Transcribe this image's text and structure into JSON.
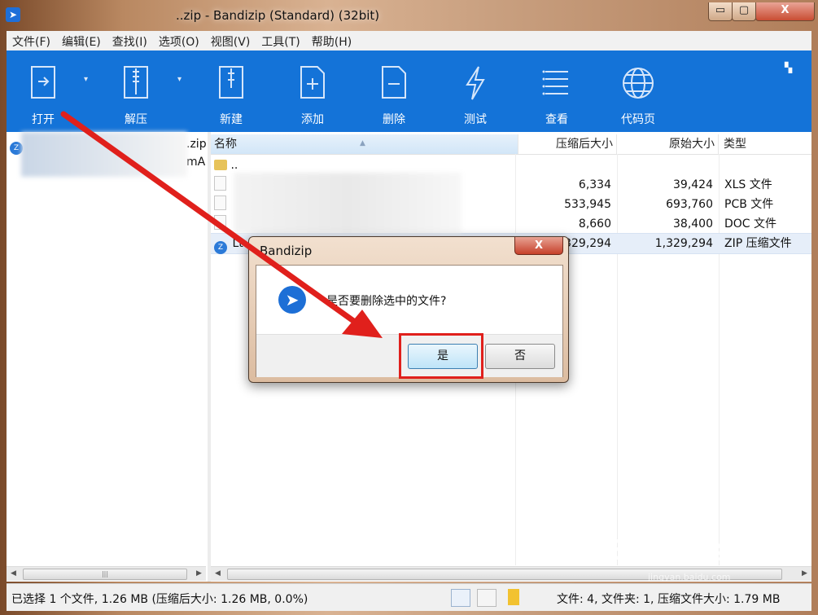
{
  "window": {
    "title": "..zip - Bandizip (Standard) (32bit)",
    "minimize": "▭",
    "maximize": "▢",
    "close": "X"
  },
  "menu": [
    "文件(F)",
    "编辑(E)",
    "查找(I)",
    "选项(O)",
    "视图(V)",
    "工具(T)",
    "帮助(H)"
  ],
  "toolbar": {
    "open": "打开",
    "extract": "解压",
    "new": "新建",
    "add": "添加",
    "delete": "删除",
    "test": "测试",
    "view": "查看",
    "codepage": "代码页"
  },
  "left_tree": {
    "root_suffix": ".zip",
    "child_suffix": "mA"
  },
  "columns": {
    "name": "名称",
    "compressed": "压缩后大小",
    "original": "原始大小",
    "type": "类型"
  },
  "files": [
    {
      "name": "..",
      "compressed": "",
      "original": "",
      "type": ""
    },
    {
      "name": "",
      "compressed": "6,334",
      "original": "39,424",
      "type": "XLS 文件"
    },
    {
      "name": "",
      "compressed": "533,945",
      "original": "693,760",
      "type": "PCB 文件"
    },
    {
      "name": "",
      "compressed": "8,660",
      "original": "38,400",
      "type": "DOC 文件"
    },
    {
      "name": "Lt",
      "compressed": "1,329,294",
      "original": "1,329,294",
      "type": "ZIP 压缩文件"
    }
  ],
  "status": {
    "left": "已选择 1 个文件, 1.26 MB (压缩后大小: 1.26 MB, 0.0%)",
    "right": "文件: 4, 文件夹: 1, 压缩文件大小: 1.79 MB"
  },
  "dialog": {
    "title": "Bandizip",
    "message": "是否要删除选中的文件?",
    "yes": "是",
    "no": "否",
    "close": "X"
  },
  "watermark": {
    "text": "Bai du 经验",
    "sub": "jingyan.baidu.com"
  },
  "colors": {
    "toolbar_bg": "#1473d8",
    "highlight_red": "#e0201c"
  }
}
